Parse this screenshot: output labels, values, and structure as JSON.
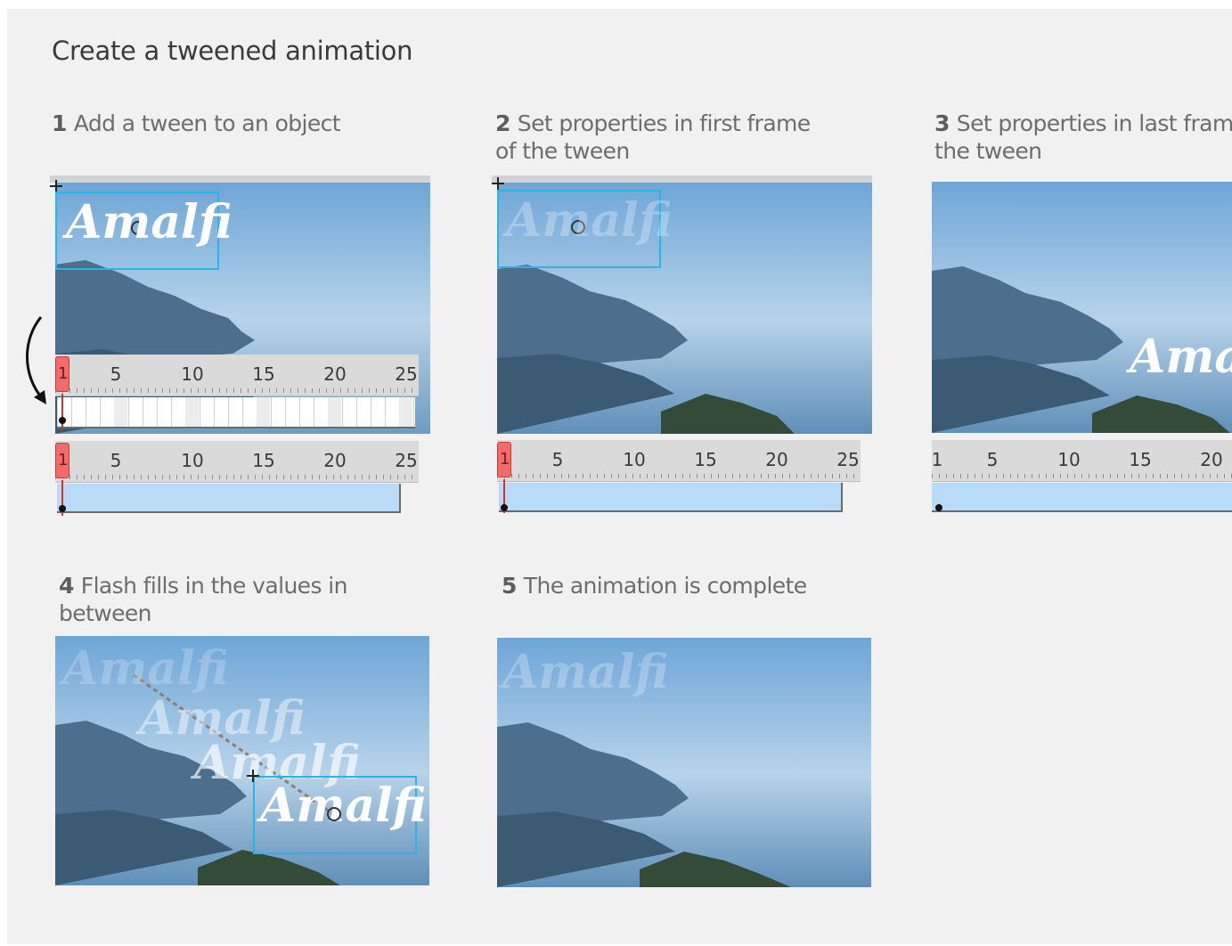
{
  "title": "Create a tweened animation",
  "steps": [
    {
      "number": "1",
      "line1": "Add a tween to an object",
      "line2": ""
    },
    {
      "number": "2",
      "line1": "Set properties in first frame",
      "line2": "of the tween"
    },
    {
      "number": "3",
      "line1": "Set properties in last frame of",
      "line2": "the tween"
    },
    {
      "number": "4",
      "line1": "Flash fills in the values in",
      "line2": "between"
    },
    {
      "number": "5",
      "line1": "The animation is complete",
      "line2": ""
    }
  ],
  "watermark_text": "Amalfi",
  "timeline": {
    "ticks": [
      "1",
      "5",
      "10",
      "15",
      "20",
      "25"
    ],
    "playhead_label": "1"
  },
  "colors": {
    "background": "#f1f1f1",
    "selection": "#29b6e6",
    "tween_span": "#b8dbf7",
    "playhead": "#f26b6b"
  }
}
